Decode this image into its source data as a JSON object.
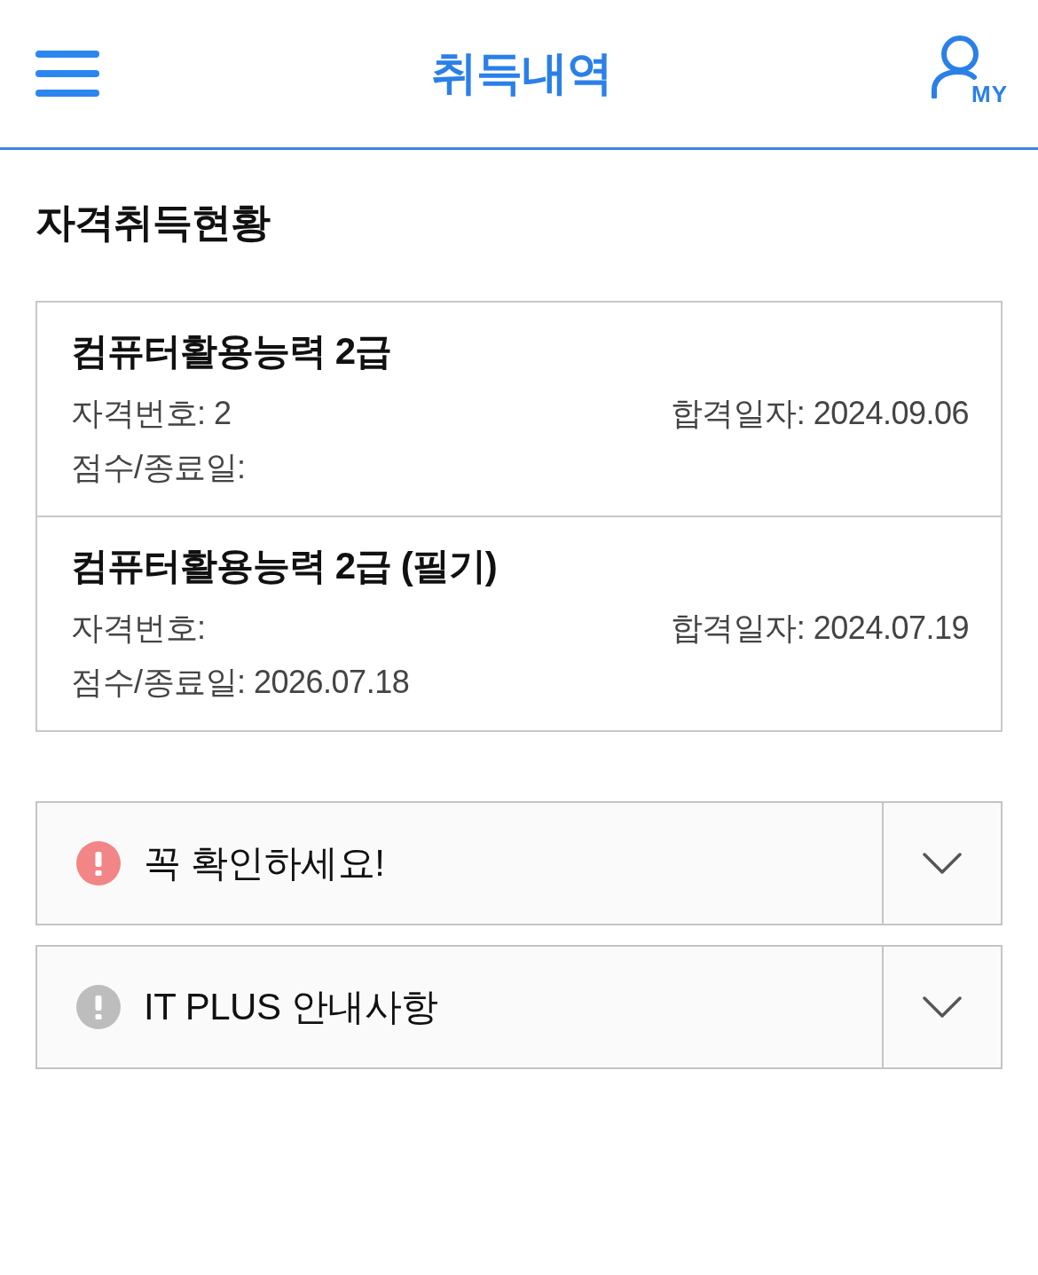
{
  "header": {
    "title": "취득내역",
    "my_label": "MY"
  },
  "section": {
    "title": "자격취득현황"
  },
  "certificates": [
    {
      "name": "컴퓨터활용능력 2급",
      "number": "자격번호: 2",
      "pass_date": "합격일자: 2024.09.06",
      "score": "점수/종료일:"
    },
    {
      "name": "컴퓨터활용능력 2급 (필기)",
      "number": "자격번호:",
      "pass_date": "합격일자: 2024.07.19",
      "score": "점수/종료일: 2026.07.18"
    }
  ],
  "notices": [
    {
      "title": "꼭 확인하세요!",
      "color": "#f28585",
      "expanded": false
    },
    {
      "title": "IT PLUS 안내사항",
      "color": "#bdbdbd",
      "expanded": false
    }
  ]
}
